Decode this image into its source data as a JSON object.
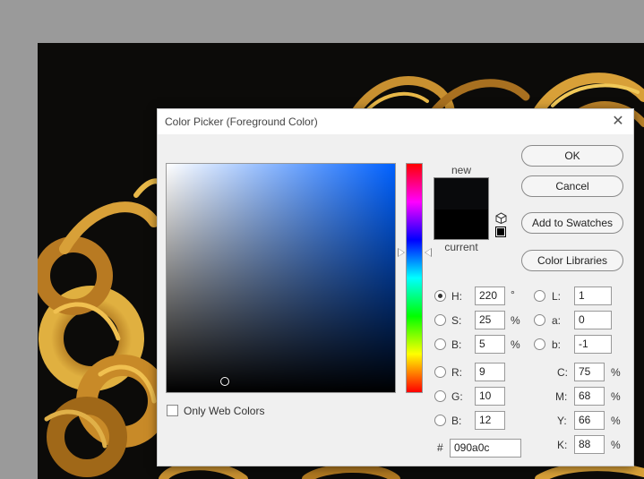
{
  "dialog": {
    "title": "Color Picker (Foreground Color)",
    "close_glyph": "✕"
  },
  "colors": {
    "new": "#090a0c",
    "current": "#000000",
    "hue_base": "#0061ff"
  },
  "swatch": {
    "new_label": "new",
    "current_label": "current"
  },
  "buttons": {
    "ok": "OK",
    "cancel": "Cancel",
    "add_to_swatches": "Add to Swatches",
    "color_libraries": "Color Libraries"
  },
  "hsb": {
    "h_label": "H:",
    "h_value": "220",
    "h_unit": "°",
    "s_label": "S:",
    "s_value": "25",
    "s_unit": "%",
    "b_label": "B:",
    "b_value": "5",
    "b_unit": "%"
  },
  "lab": {
    "l_label": "L:",
    "l_value": "1",
    "a_label": "a:",
    "a_value": "0",
    "b_label": "b:",
    "b_value": "-1"
  },
  "rgb": {
    "r_label": "R:",
    "r_value": "9",
    "g_label": "G:",
    "g_value": "10",
    "b_label": "B:",
    "b_value": "12"
  },
  "cmyk": {
    "c_label": "C:",
    "c_value": "75",
    "c_unit": "%",
    "m_label": "M:",
    "m_value": "68",
    "m_unit": "%",
    "y_label": "Y:",
    "y_value": "66",
    "y_unit": "%",
    "k_label": "K:",
    "k_value": "88",
    "k_unit": "%"
  },
  "hex": {
    "label": "#",
    "value": "090a0c"
  },
  "web_colors": {
    "label": "Only Web Colors"
  }
}
